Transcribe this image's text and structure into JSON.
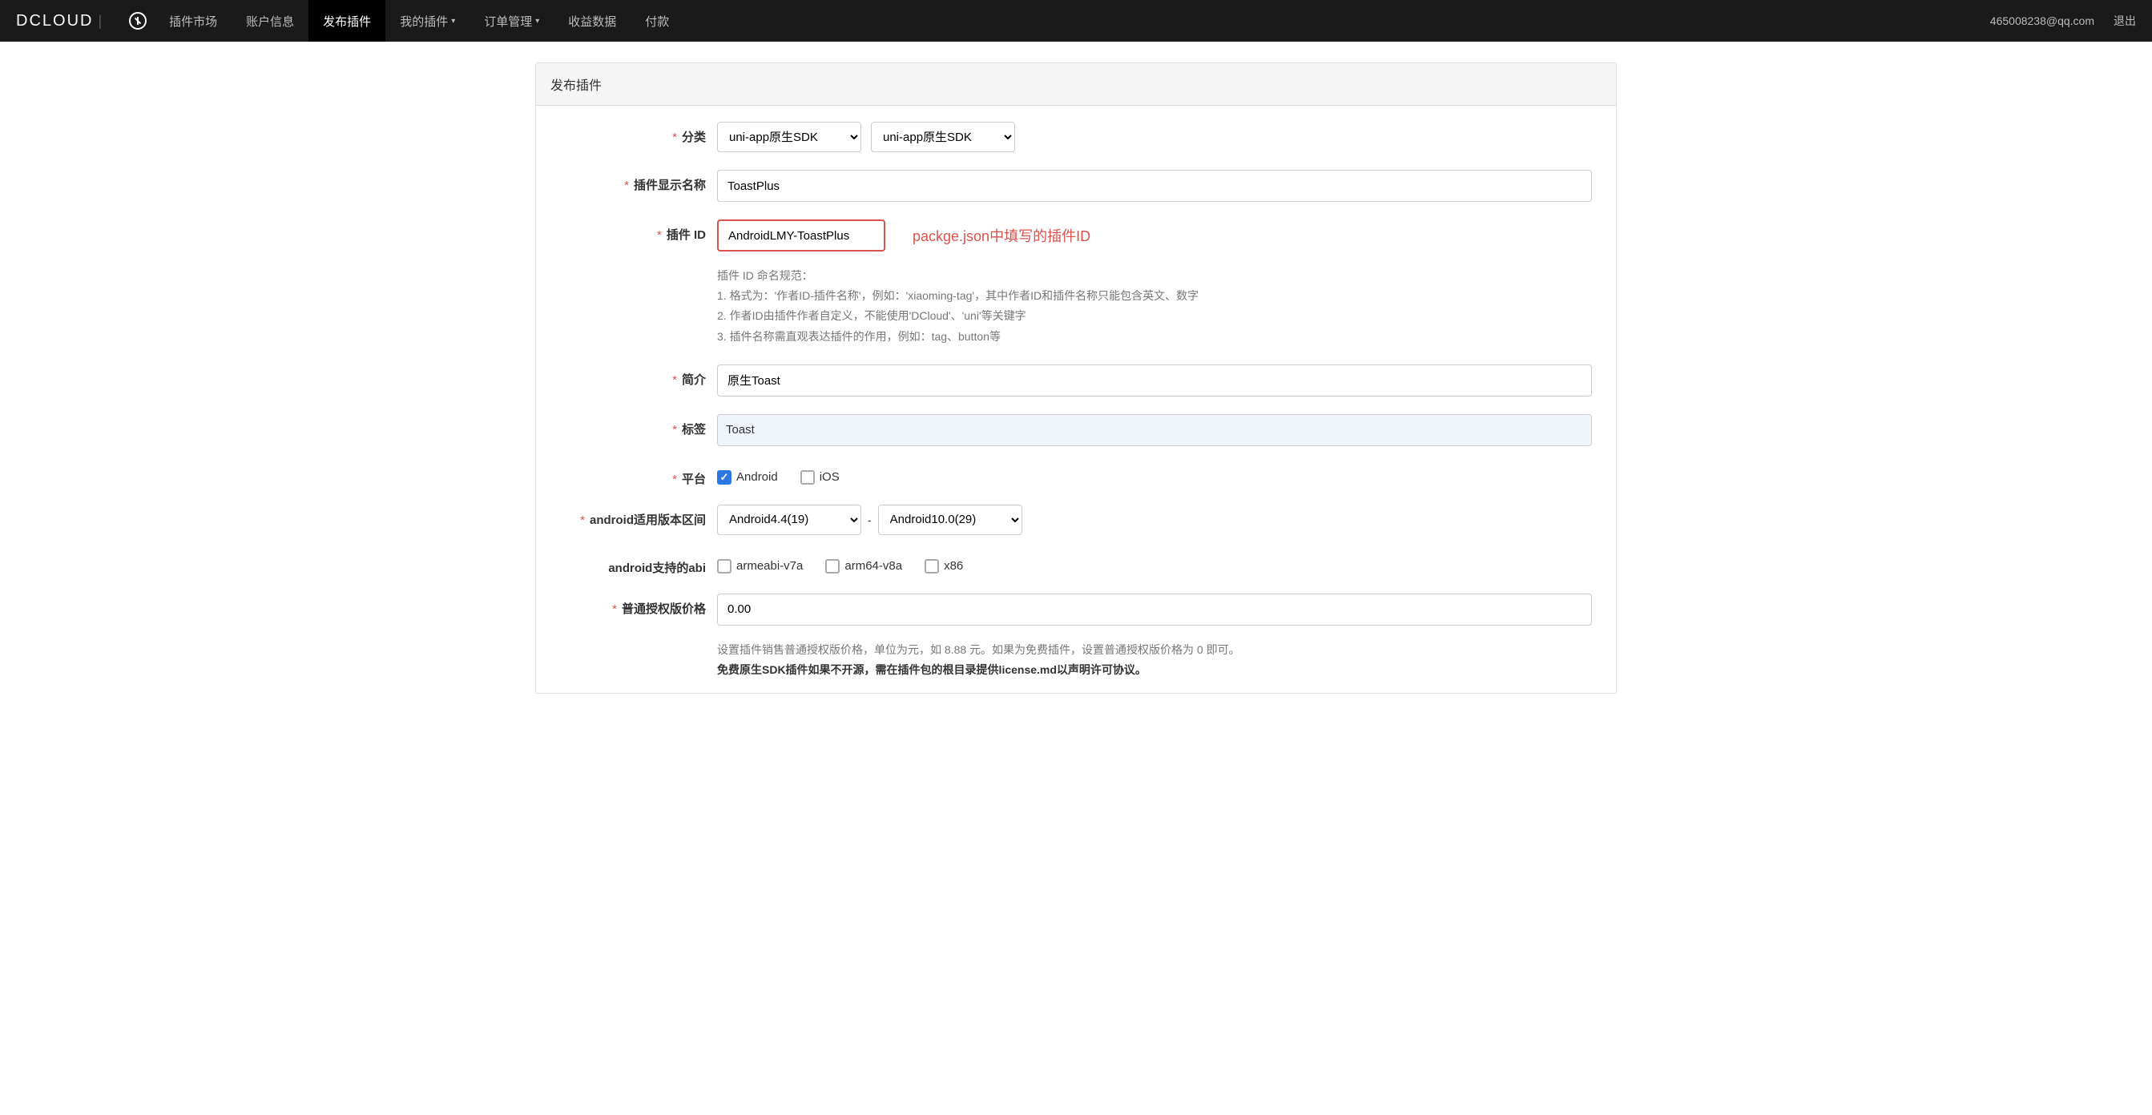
{
  "header": {
    "logo_text": "DCLOUD",
    "market_label": "插件市场",
    "nav": [
      {
        "label": "账户信息",
        "dropdown": false
      },
      {
        "label": "发布插件",
        "dropdown": false,
        "active": true
      },
      {
        "label": "我的插件",
        "dropdown": true
      },
      {
        "label": "订单管理",
        "dropdown": true
      },
      {
        "label": "收益数据",
        "dropdown": false
      },
      {
        "label": "付款",
        "dropdown": false
      }
    ],
    "user_email": "465008238@qq.com",
    "logout": "退出"
  },
  "panel_title": "发布插件",
  "form": {
    "category": {
      "label": "分类",
      "select1": "uni-app原生SDK",
      "select2": "uni-app原生SDK"
    },
    "display_name": {
      "label": "插件显示名称",
      "value": "ToastPlus"
    },
    "plugin_id": {
      "label": "插件 ID",
      "value": "AndroidLMY-ToastPlus",
      "annotation": "packge.json中填写的插件ID",
      "hint_title": "插件 ID 命名规范：",
      "hint_lines": [
        "1. 格式为：'作者ID-插件名称'，例如：'xiaoming-tag'，其中作者ID和插件名称只能包含英文、数字",
        "2. 作者ID由插件作者自定义，不能使用'DCloud'、'uni'等关键字",
        "3. 插件名称需直观表达插件的作用，例如：tag、button等"
      ]
    },
    "intro": {
      "label": "简介",
      "value": "原生Toast"
    },
    "tags": {
      "label": "标签",
      "value": "Toast"
    },
    "platform": {
      "label": "平台",
      "options": [
        {
          "label": "Android",
          "checked": true
        },
        {
          "label": "iOS",
          "checked": false
        }
      ]
    },
    "android_version": {
      "label": "android适用版本区间",
      "from": "Android4.4(19)",
      "sep": "-",
      "to": "Android10.0(29)"
    },
    "abi": {
      "label": "android支持的abi",
      "options": [
        {
          "label": "armeabi-v7a",
          "checked": false
        },
        {
          "label": "arm64-v8a",
          "checked": false
        },
        {
          "label": "x86",
          "checked": false
        }
      ]
    },
    "price": {
      "label": "普通授权版价格",
      "value": "0.00",
      "hint_line1": "设置插件销售普通授权版价格，单位为元，如 8.88 元。如果为免费插件，设置普通授权版价格为 0 即可。",
      "hint_line2": "免费原生SDK插件如果不开源，需在插件包的根目录提供license.md以声明许可协议。"
    }
  }
}
